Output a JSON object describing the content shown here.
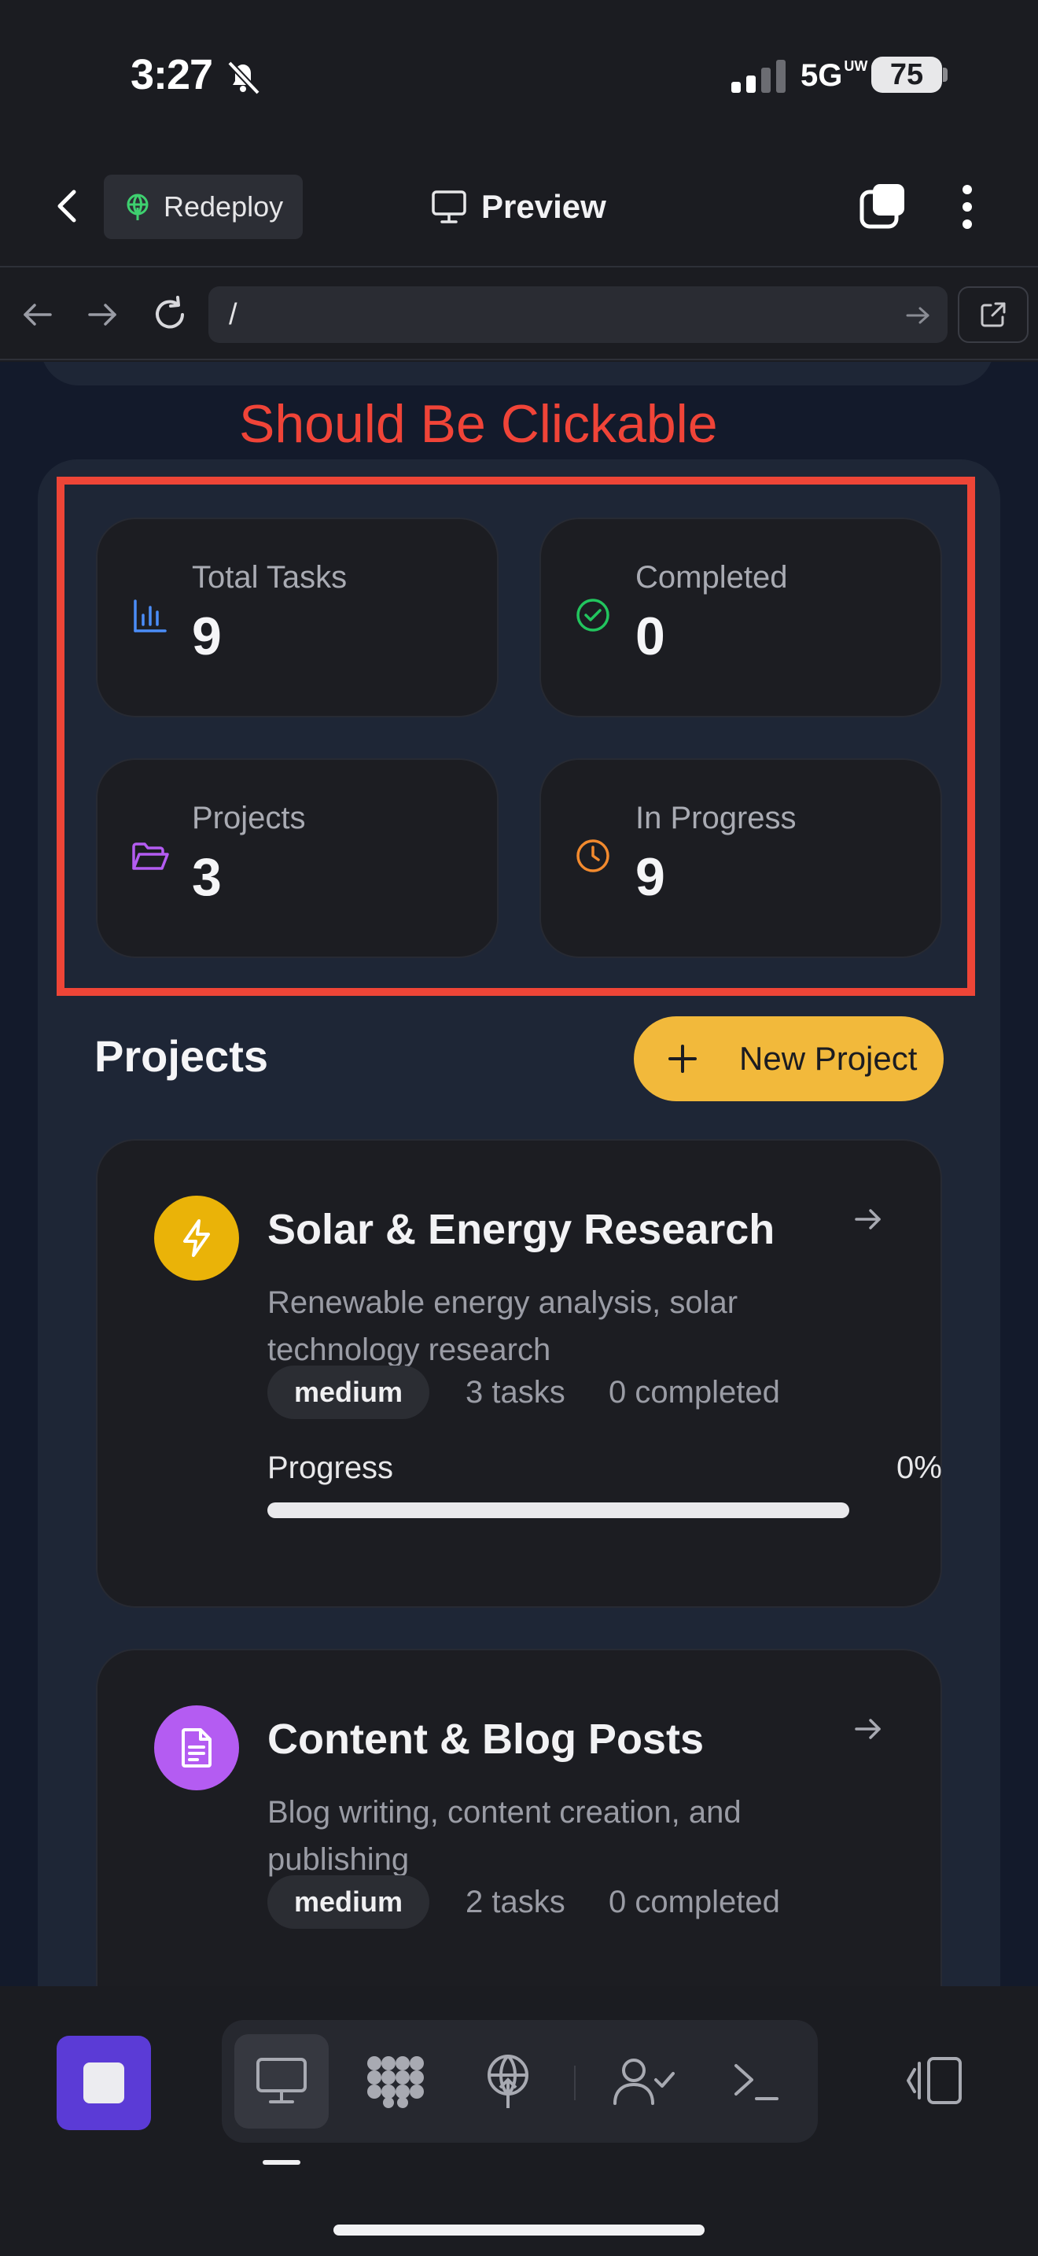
{
  "status_bar": {
    "time": "3:27",
    "network": "5G",
    "network_sup": "UW",
    "battery": "75"
  },
  "header": {
    "redeploy_label": "Redeploy",
    "title": "Preview"
  },
  "url_bar": {
    "value": "/"
  },
  "annotation": {
    "text": "Should Be Clickable",
    "color": "#f04438"
  },
  "stats": [
    {
      "label": "Total Tasks",
      "value": "9",
      "icon": "bar-chart-icon",
      "color": "#4b8df8"
    },
    {
      "label": "Completed",
      "value": "0",
      "icon": "check-circle-icon",
      "color": "#22c55e"
    },
    {
      "label": "Projects",
      "value": "3",
      "icon": "folder-open-icon",
      "color": "#b45cf2"
    },
    {
      "label": "In Progress",
      "value": "9",
      "icon": "clock-icon",
      "color": "#f28a2e"
    }
  ],
  "projects_section": {
    "heading": "Projects",
    "new_project_label": "New Project"
  },
  "projects": [
    {
      "title": "Solar & Energy Research",
      "description": "Renewable energy analysis, solar technology research",
      "priority": "medium",
      "tasks": "3 tasks",
      "completed": "0 completed",
      "progress_label": "Progress",
      "progress_text": "0%",
      "progress": 0,
      "icon": "lightning-icon",
      "color": "#eab308"
    },
    {
      "title": "Content & Blog Posts",
      "description": "Blog writing, content creation, and publishing",
      "priority": "medium",
      "tasks": "2 tasks",
      "completed": "0 completed",
      "icon": "document-icon",
      "color": "#b45cf2"
    }
  ],
  "colors": {
    "accent": "#f2b93b",
    "stop_button": "#5b3bd6",
    "background": "#131a2b"
  }
}
